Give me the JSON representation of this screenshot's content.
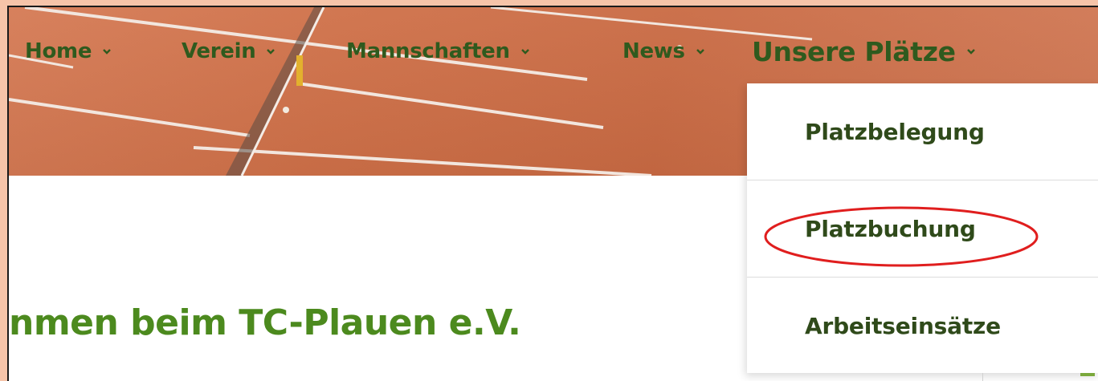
{
  "nav": {
    "items": [
      {
        "label": "Home"
      },
      {
        "label": "Verein"
      },
      {
        "label": "Mannschaften"
      },
      {
        "label": "News"
      },
      {
        "label": "Unsere Plätze"
      }
    ]
  },
  "dropdown": {
    "items": [
      {
        "label": "Platzbelegung"
      },
      {
        "label": "Platzbuchung"
      },
      {
        "label": "Arbeitseinsätze"
      }
    ]
  },
  "page": {
    "heading": "nmen beim TC-Plauen e.V."
  },
  "colors": {
    "nav_text": "#2f5a1e",
    "heading": "#4c8a1e",
    "court": "#cf7048",
    "highlight_circle": "#e01e1e",
    "page_border": "#f6c4a9"
  },
  "icons": {
    "nav_dropdown": "chevron-down-icon"
  }
}
